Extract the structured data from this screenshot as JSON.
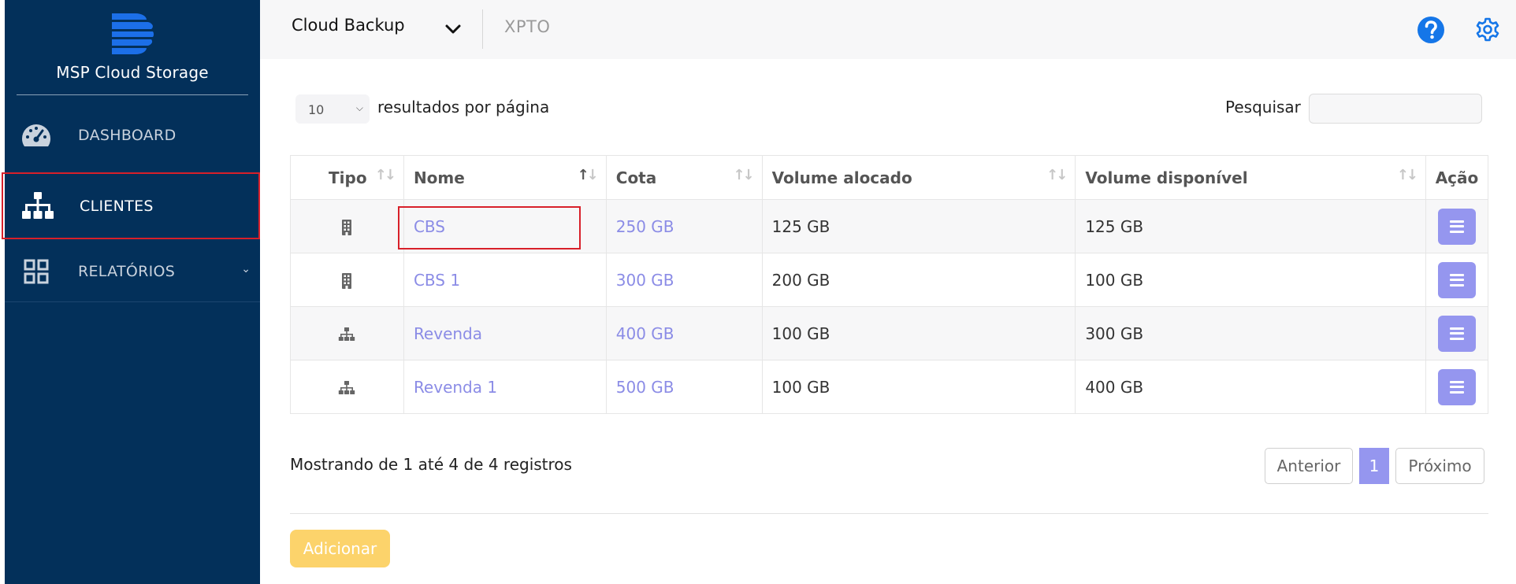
{
  "app": {
    "name": "MSP Cloud Storage",
    "logo_icon": "stacked-d-logo-icon"
  },
  "colors": {
    "sidebar_bg": "#03305a",
    "accent": "#9596ef",
    "link": "#8b8ce6",
    "add_button": "#fcd36b",
    "help_icon": "#1576e8",
    "highlight": "#d8202a"
  },
  "sidebar": {
    "items": [
      {
        "label": "DASHBOARD",
        "icon": "speedometer-icon"
      },
      {
        "label": "CLIENTES",
        "icon": "org-chart-icon"
      },
      {
        "label": "RELATÓRIOS",
        "icon": "grid-icon"
      }
    ]
  },
  "topbar": {
    "product": "Cloud Backup",
    "company": "XPTO",
    "help_icon": "question-circle-icon",
    "settings_icon": "gear-icon"
  },
  "controls": {
    "page_size": "10",
    "page_size_label": "resultados por página",
    "search_label": "Pesquisar",
    "search_value": ""
  },
  "table": {
    "headers": {
      "tipo": "Tipo",
      "nome": "Nome",
      "cota": "Cota",
      "alocado": "Volume alocado",
      "disponivel": "Volume disponível",
      "acao": "Ação"
    },
    "rows": [
      {
        "type": "building-icon",
        "nome": "CBS",
        "cota": "250 GB",
        "alocado": "125 GB",
        "disponivel": "125 GB"
      },
      {
        "type": "building-icon",
        "nome": "CBS 1",
        "cota": "300 GB",
        "alocado": "200 GB",
        "disponivel": "100 GB"
      },
      {
        "type": "org-chart-icon",
        "nome": "Revenda",
        "cota": "400 GB",
        "alocado": "100 GB",
        "disponivel": "300 GB"
      },
      {
        "type": "org-chart-icon",
        "nome": "Revenda 1",
        "cota": "500 GB",
        "alocado": "100 GB",
        "disponivel": "400 GB"
      }
    ]
  },
  "footer": {
    "info": "Mostrando de 1 até 4 de 4 registros",
    "prev": "Anterior",
    "page": "1",
    "next": "Próximo",
    "add": "Adicionar"
  }
}
